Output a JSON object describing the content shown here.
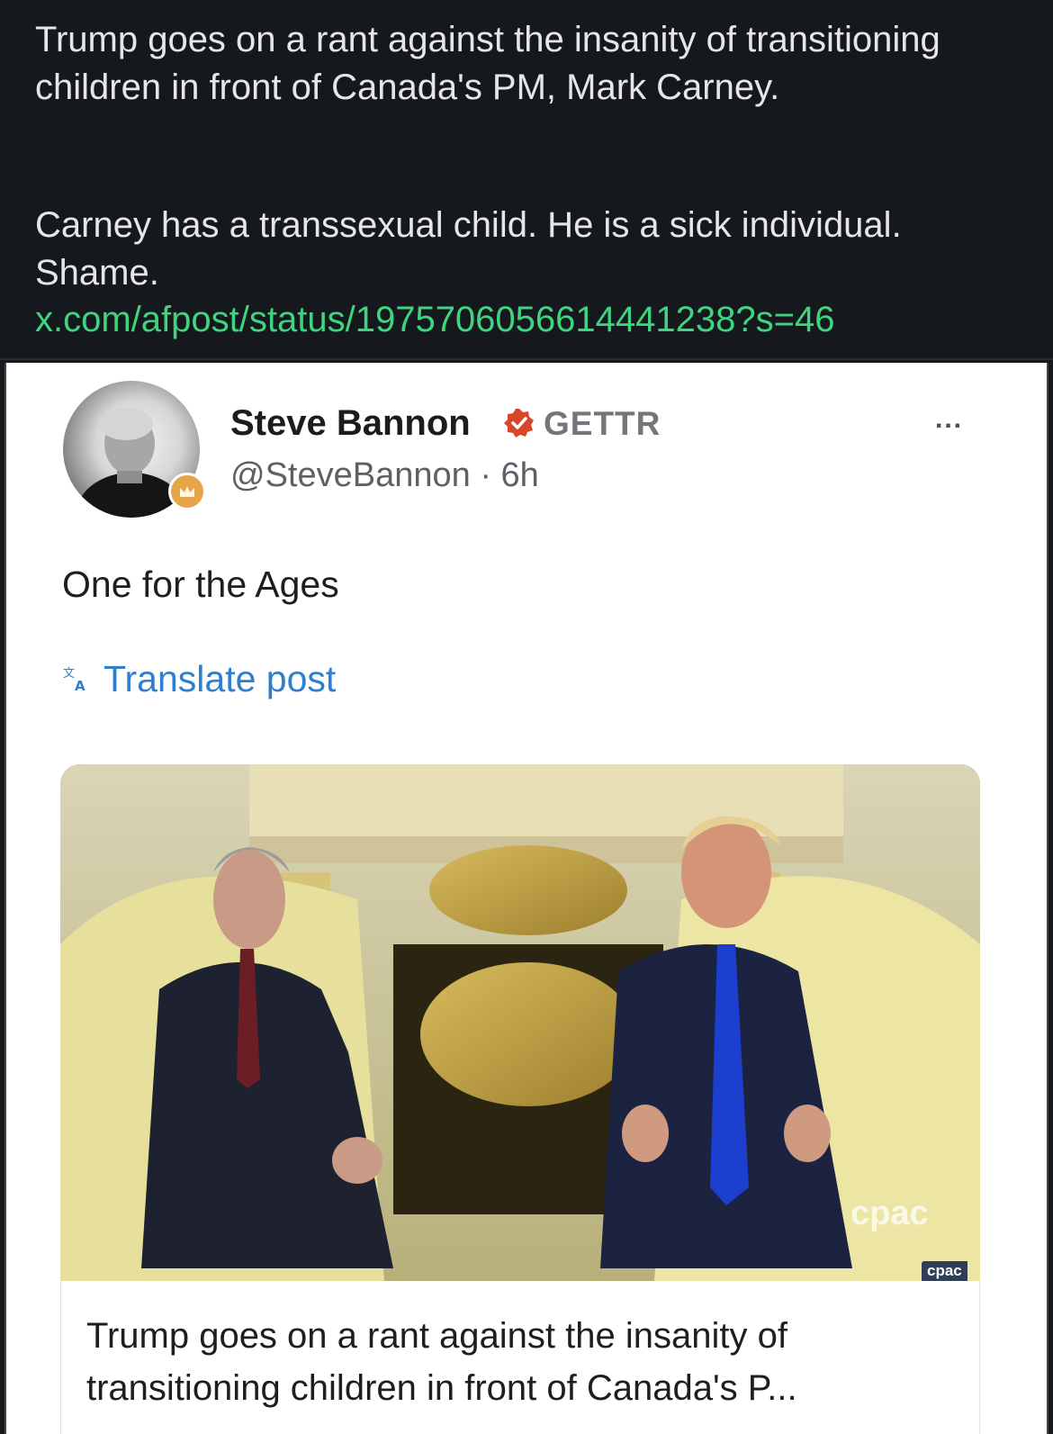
{
  "top_post": {
    "paragraph_1": "Trump goes on a rant against the insanity of transitioning children in front of Canada's PM, Mark Carney.",
    "paragraph_2": "Carney has a transsexual child. He is a sick individual. Shame.",
    "link": "x.com/afpost/status/1975706056614441238?s=46"
  },
  "embedded_post": {
    "author_name": "Steve Bannon",
    "platform": "GETTR",
    "handle_time": "@SteveBannon · 6h",
    "more_label": "...",
    "text": "One for the Ages",
    "translate_label": "Translate post",
    "media": {
      "watermark": "cpac",
      "watermark_small": "cpac"
    },
    "link_preview_title": "Trump goes on a rant against the insanity of transitioning children in front of Canada's P..."
  },
  "colors": {
    "background": "#15181d",
    "link_green": "#3fd47f",
    "translate_blue": "#2e7fcf",
    "verified_red": "#d9472b"
  },
  "icons": {
    "verified": "verified-check-icon",
    "more": "more-dots-icon",
    "translate": "translate-icon",
    "badge": "crown-badge-icon"
  }
}
